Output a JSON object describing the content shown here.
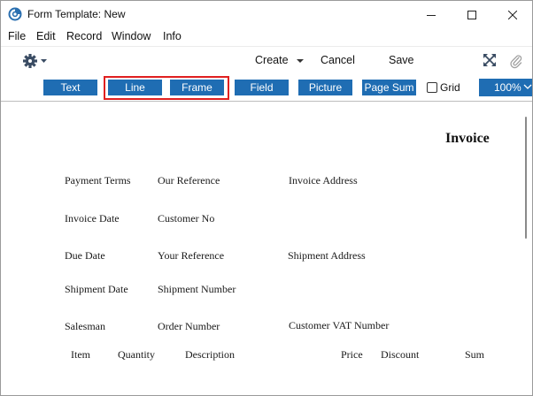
{
  "window": {
    "title": "Form Template: New",
    "icon": "app-logo-icon",
    "controls": [
      "minimize-icon",
      "maximize-icon",
      "close-icon"
    ]
  },
  "menu": [
    "File",
    "Edit",
    "Record",
    "Window",
    "Info"
  ],
  "toolbar": {
    "gear_icon": "gear-icon",
    "create_label": "Create",
    "cancel_label": "Cancel",
    "save_label": "Save",
    "expand_icon": "expand-icon",
    "attach_icon": "paperclip-icon"
  },
  "tools": {
    "text": "Text",
    "line": "Line",
    "frame": "Frame",
    "field": "Field",
    "picture": "Picture",
    "page_sum": "Page Sum",
    "grid_label": "Grid",
    "grid_checked": false,
    "zoom": "100%"
  },
  "colors": {
    "tool_button": "#1f6db3",
    "highlight": "#e02020"
  },
  "form": {
    "title": "Invoice",
    "fields": {
      "payment_terms": "Payment Terms",
      "our_reference": "Our Reference",
      "invoice_address": "Invoice Address",
      "invoice_date": "Invoice Date",
      "customer_no": "Customer No",
      "due_date": "Due Date",
      "your_reference": "Your Reference",
      "shipment_address": "Shipment Address",
      "shipment_date": "Shipment Date",
      "shipment_number": "Shipment Number",
      "salesman": "Salesman",
      "order_number": "Order Number",
      "customer_vat": "Customer VAT Number"
    },
    "columns": {
      "item": "Item",
      "quantity": "Quantity",
      "description": "Description",
      "price": "Price",
      "discount": "Discount",
      "sum": "Sum"
    }
  }
}
